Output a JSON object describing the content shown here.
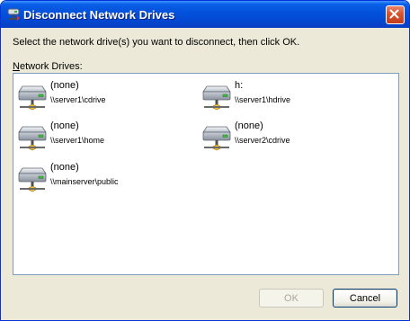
{
  "window": {
    "title": "Disconnect Network Drives"
  },
  "dialog": {
    "instruction": "Select the network drive(s) you want to disconnect, then click OK.",
    "list_label_mnemonic": "N",
    "list_label_rest": "etwork Drives:"
  },
  "drives": [
    {
      "name": "(none)",
      "path": "\\\\server1\\cdrive"
    },
    {
      "name": "h:",
      "path": "\\\\server1\\hdrive"
    },
    {
      "name": "(none)",
      "path": "\\\\server1\\home"
    },
    {
      "name": "(none)",
      "path": "\\\\server2\\cdrive"
    },
    {
      "name": "(none)",
      "path": "\\\\mainserver\\public"
    }
  ],
  "buttons": {
    "ok": "OK",
    "cancel": "Cancel"
  },
  "colors": {
    "titlebar": "#0453dd",
    "window_bg": "#ece9d8",
    "list_border": "#7f9db9",
    "close_button": "#d6532f"
  },
  "icons": {
    "title": "network-drive-icon",
    "drive": "network-drive-icon",
    "close": "close-icon"
  }
}
